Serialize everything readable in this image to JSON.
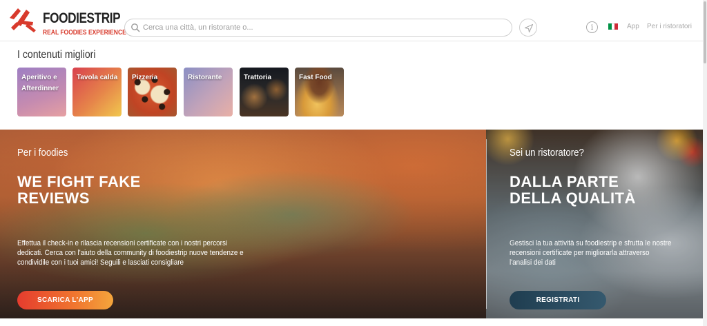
{
  "header": {
    "logo_title": "FOODIESTRIP",
    "logo_tagline": "REAL FOODIES EXPERIENCE",
    "search_placeholder": "Cerca una città, un ristorante o...",
    "info_label": "i",
    "nav": {
      "app": "App",
      "restaurants": "Per i ristoratori"
    }
  },
  "categories": {
    "title": "I contenuti migliori",
    "items": [
      {
        "label": "Aperitivo e Afterdinner"
      },
      {
        "label": "Tavola calda"
      },
      {
        "label": "Pizzeria"
      },
      {
        "label": "Ristorante"
      },
      {
        "label": "Trattoria"
      },
      {
        "label": "Fast Food"
      }
    ]
  },
  "hero": {
    "left": {
      "subtitle": "Per i foodies",
      "title_line1": "WE FIGHT FAKE",
      "title_line2": "REVIEWS",
      "description": "Effettua il check-in e rilascia recensioni certificate con i nostri percorsi dedicati. Cerca con l'aiuto della community di foodiestrip nuove tendenze e condividile con i tuoi amici! Seguili e lasciati consigliare",
      "button": "SCARICA L'APP"
    },
    "right": {
      "subtitle": "Sei un ristoratore?",
      "title_line1": "DALLA PARTE",
      "title_line2": "DELLA QUALITÀ",
      "description": "Gestisci la tua attività su foodiestrip e sfrutta le nostre recensioni certificate per migliorarla attraverso l'analisi dei dati",
      "button": "REGISTRATI"
    }
  },
  "colors": {
    "brand_red": "#d83a2c",
    "app_button_gradient": [
      "#e53c2e",
      "#f4a53c"
    ],
    "register_button_gradient": [
      "#1f3d50",
      "#35596e"
    ],
    "flag": [
      "#009246",
      "#ffffff",
      "#ce2b37"
    ]
  },
  "icons": [
    "logo-mark-icon",
    "search-icon",
    "location-arrow-icon",
    "info-icon",
    "italy-flag-icon"
  ]
}
